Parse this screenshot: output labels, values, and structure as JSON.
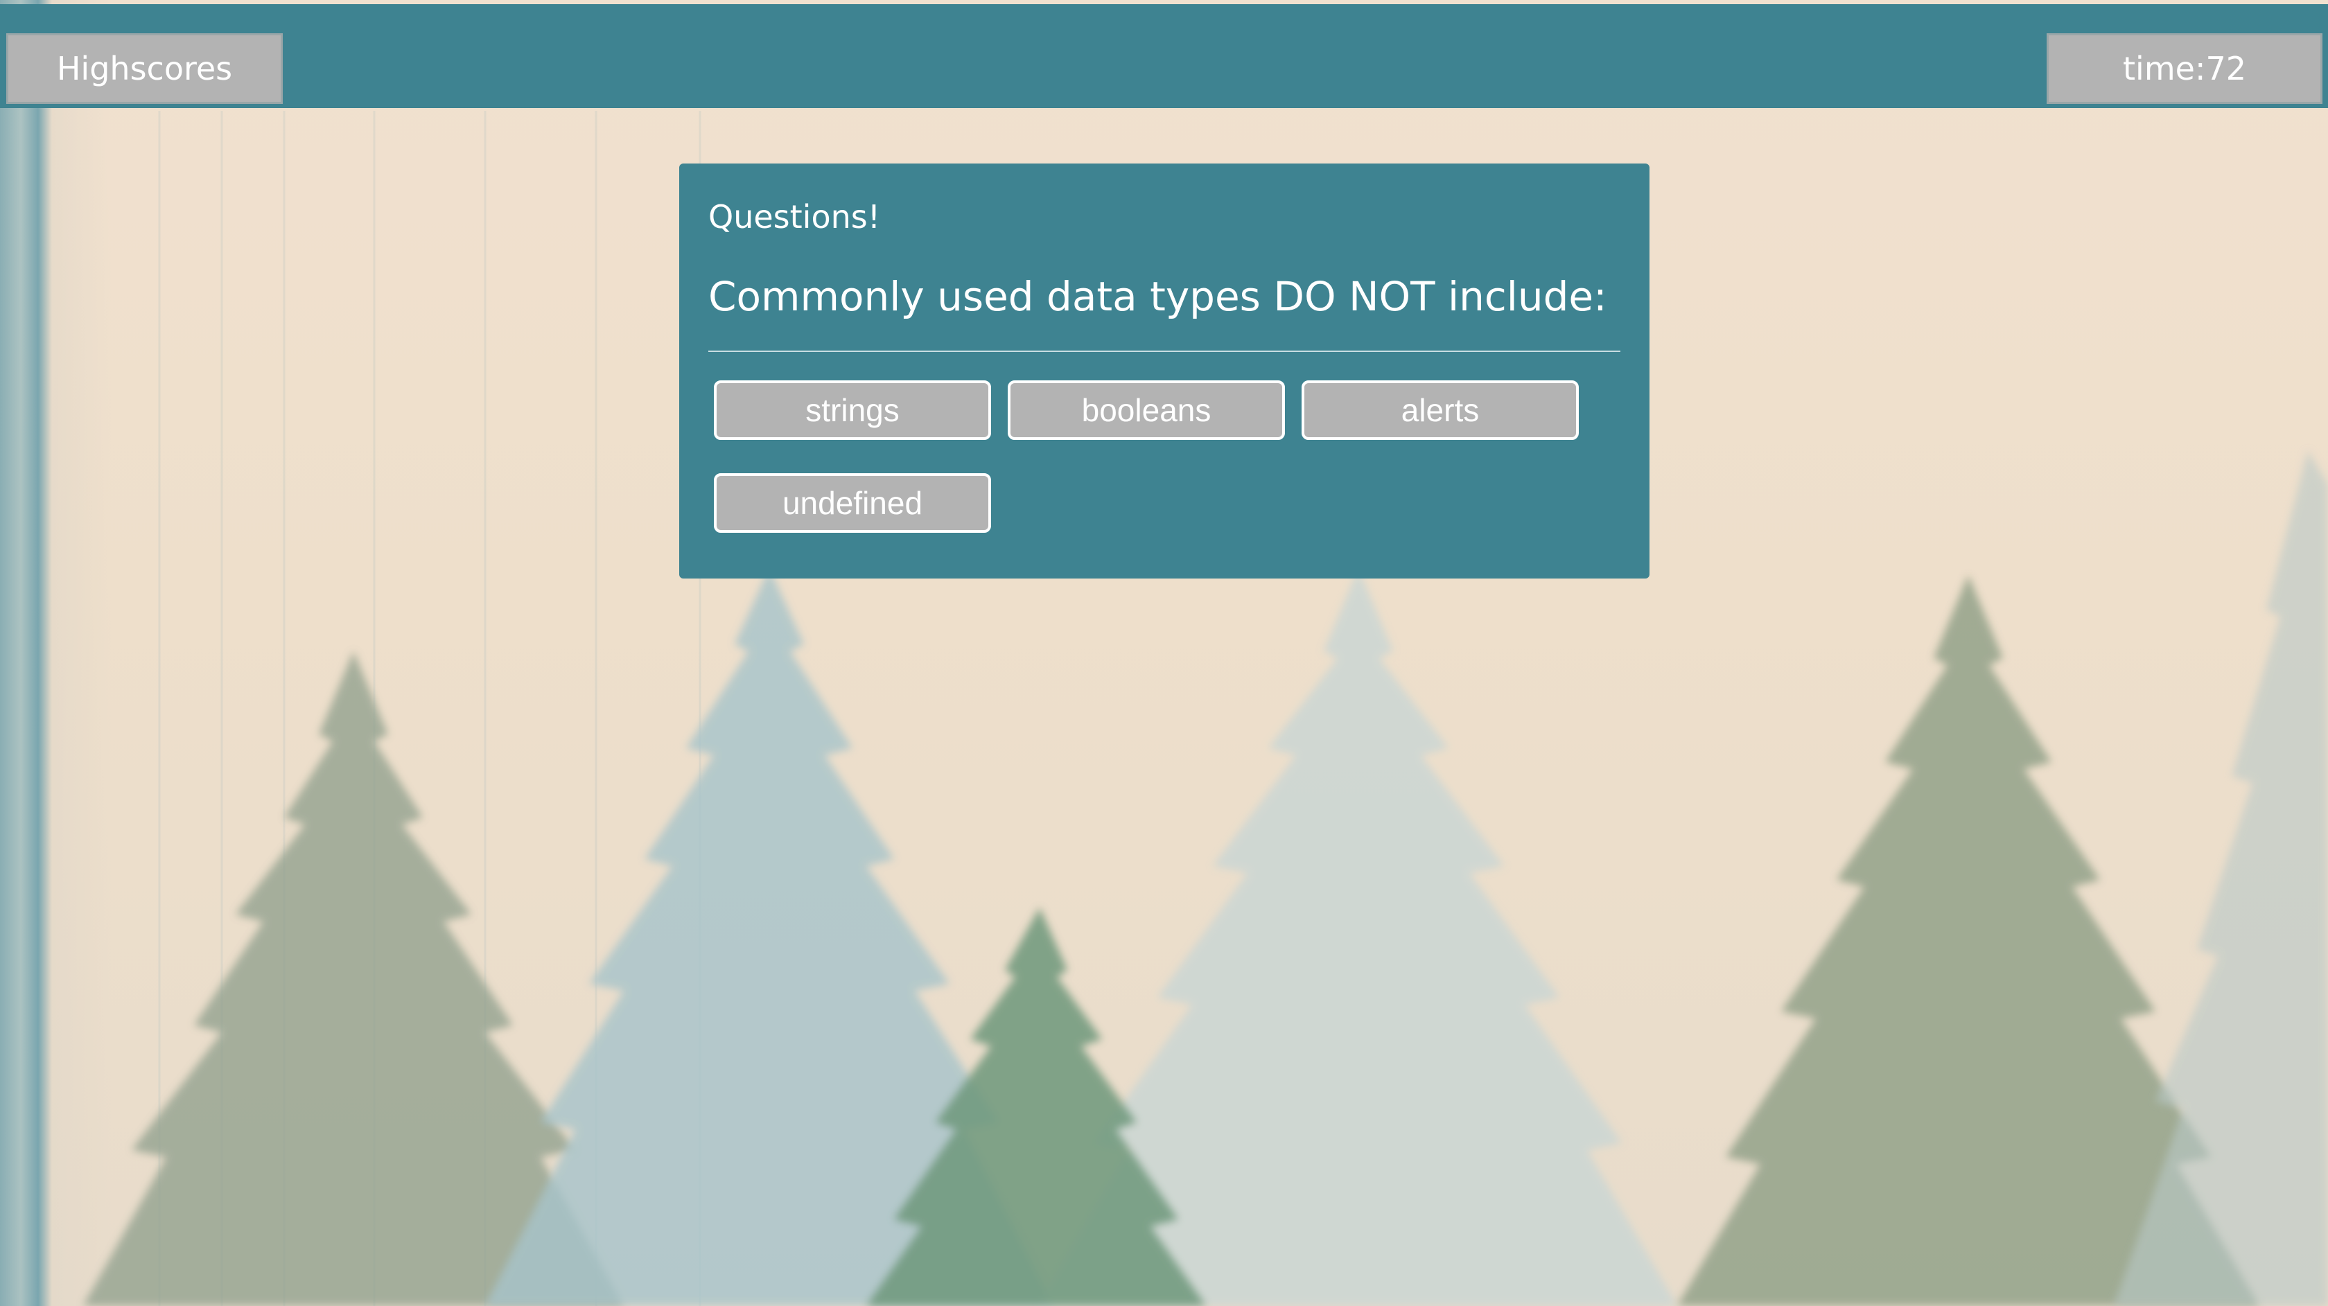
{
  "header": {
    "highscores_label": "Highscores",
    "timer_label": "time:72"
  },
  "quiz": {
    "heading": "Questions!",
    "question": "Commonly used data types DO NOT include:",
    "answers": [
      {
        "label": "strings"
      },
      {
        "label": "booleans"
      },
      {
        "label": "alerts"
      },
      {
        "label": "undefined"
      }
    ]
  },
  "colors": {
    "header_bg": "#3e8391",
    "card_bg": "#3e8391",
    "button_bg": "#b3b3b3",
    "page_bg": "#eddcc8"
  },
  "icons": []
}
